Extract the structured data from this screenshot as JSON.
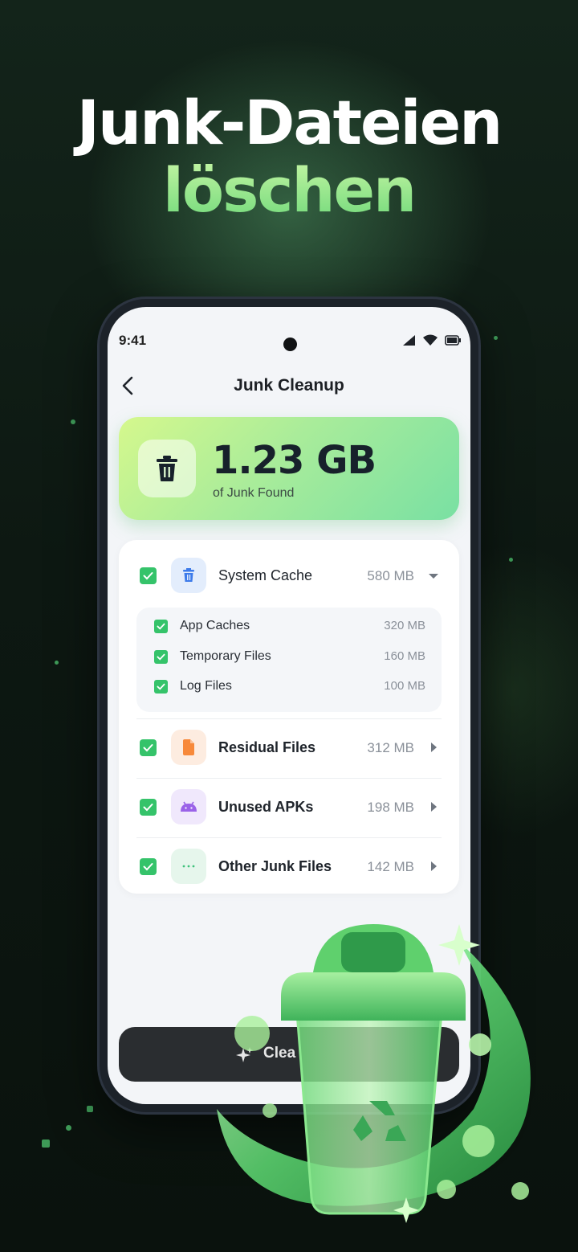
{
  "headline": {
    "line1": "Junk-Dateien",
    "line2": "löschen"
  },
  "status_bar": {
    "time": "9:41"
  },
  "header": {
    "title": "Junk Cleanup"
  },
  "summary": {
    "size": "1.23 GB",
    "caption": "of Junk Found"
  },
  "categories": [
    {
      "label": "System Cache",
      "size": "580 MB",
      "checked": true,
      "expanded": true,
      "icon": "trash-icon",
      "children": [
        {
          "label": "App Caches",
          "size": "320 MB",
          "checked": true
        },
        {
          "label": "Temporary Files",
          "size": "160 MB",
          "checked": true
        },
        {
          "label": "Log Files",
          "size": "100 MB",
          "checked": true
        }
      ]
    },
    {
      "label": "Residual Files",
      "size": "312 MB",
      "checked": true,
      "icon": "file-icon"
    },
    {
      "label": "Unused APKs",
      "size": "198 MB",
      "checked": true,
      "icon": "android-icon"
    },
    {
      "label": "Other Junk Files",
      "size": "142 MB",
      "checked": true,
      "icon": "dots-icon"
    }
  ],
  "clean_button": {
    "label": "Clea"
  },
  "colors": {
    "accent": "#35c36a",
    "headline_green": "#9be58f",
    "background": "#0c140f"
  }
}
